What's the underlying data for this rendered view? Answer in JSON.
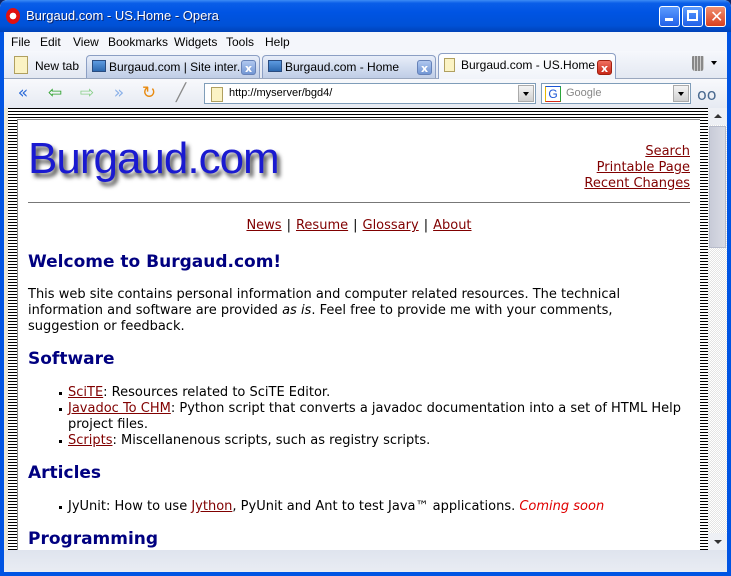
{
  "window": {
    "title": "Burgaud.com - US.Home - Opera"
  },
  "menu": [
    "File",
    "Edit",
    "View",
    "Bookmarks",
    "Widgets",
    "Tools",
    "Help"
  ],
  "tabs": {
    "new_tab_label": "New tab",
    "items": [
      {
        "label": "Burgaud.com | Site inter...",
        "active": false
      },
      {
        "label": "Burgaud.com - Home",
        "active": false
      },
      {
        "label": "Burgaud.com - US.Home",
        "active": true
      }
    ]
  },
  "toolbar": {
    "address": "http://myserver/bgd4/",
    "search_placeholder": "Google",
    "search_engine_icon": "G"
  },
  "page": {
    "logo": "Burgaud.com",
    "top_links": [
      "Search",
      "Printable Page",
      "Recent Changes"
    ],
    "nav_links": [
      "News",
      "Resume",
      "Glossary",
      "About"
    ],
    "nav_sep": "|",
    "welcome_heading": "Welcome to Burgaud.com!",
    "intro_1": "This web site contains personal information and computer related resources. The technical information and software are provided ",
    "intro_em": "as is",
    "intro_2": ". Feel free to provide me with your comments, suggestion or feedback.",
    "software_heading": "Software",
    "software": [
      {
        "link": "SciTE",
        "text": ": Resources related to SciTE Editor."
      },
      {
        "link": "Javadoc To CHM",
        "text": ": Python script that converts a javadoc documentation into a set of HTML Help project files."
      },
      {
        "link": "Scripts",
        "text": ": Miscellanenous scripts, such as registry scripts."
      }
    ],
    "articles_heading": "Articles",
    "article": {
      "pre": "JyUnit: How to use ",
      "link": "Jython",
      "post": ", PyUnit and Ant to test Java™ applications. ",
      "status": "Coming soon"
    },
    "programming_heading": "Programming"
  }
}
